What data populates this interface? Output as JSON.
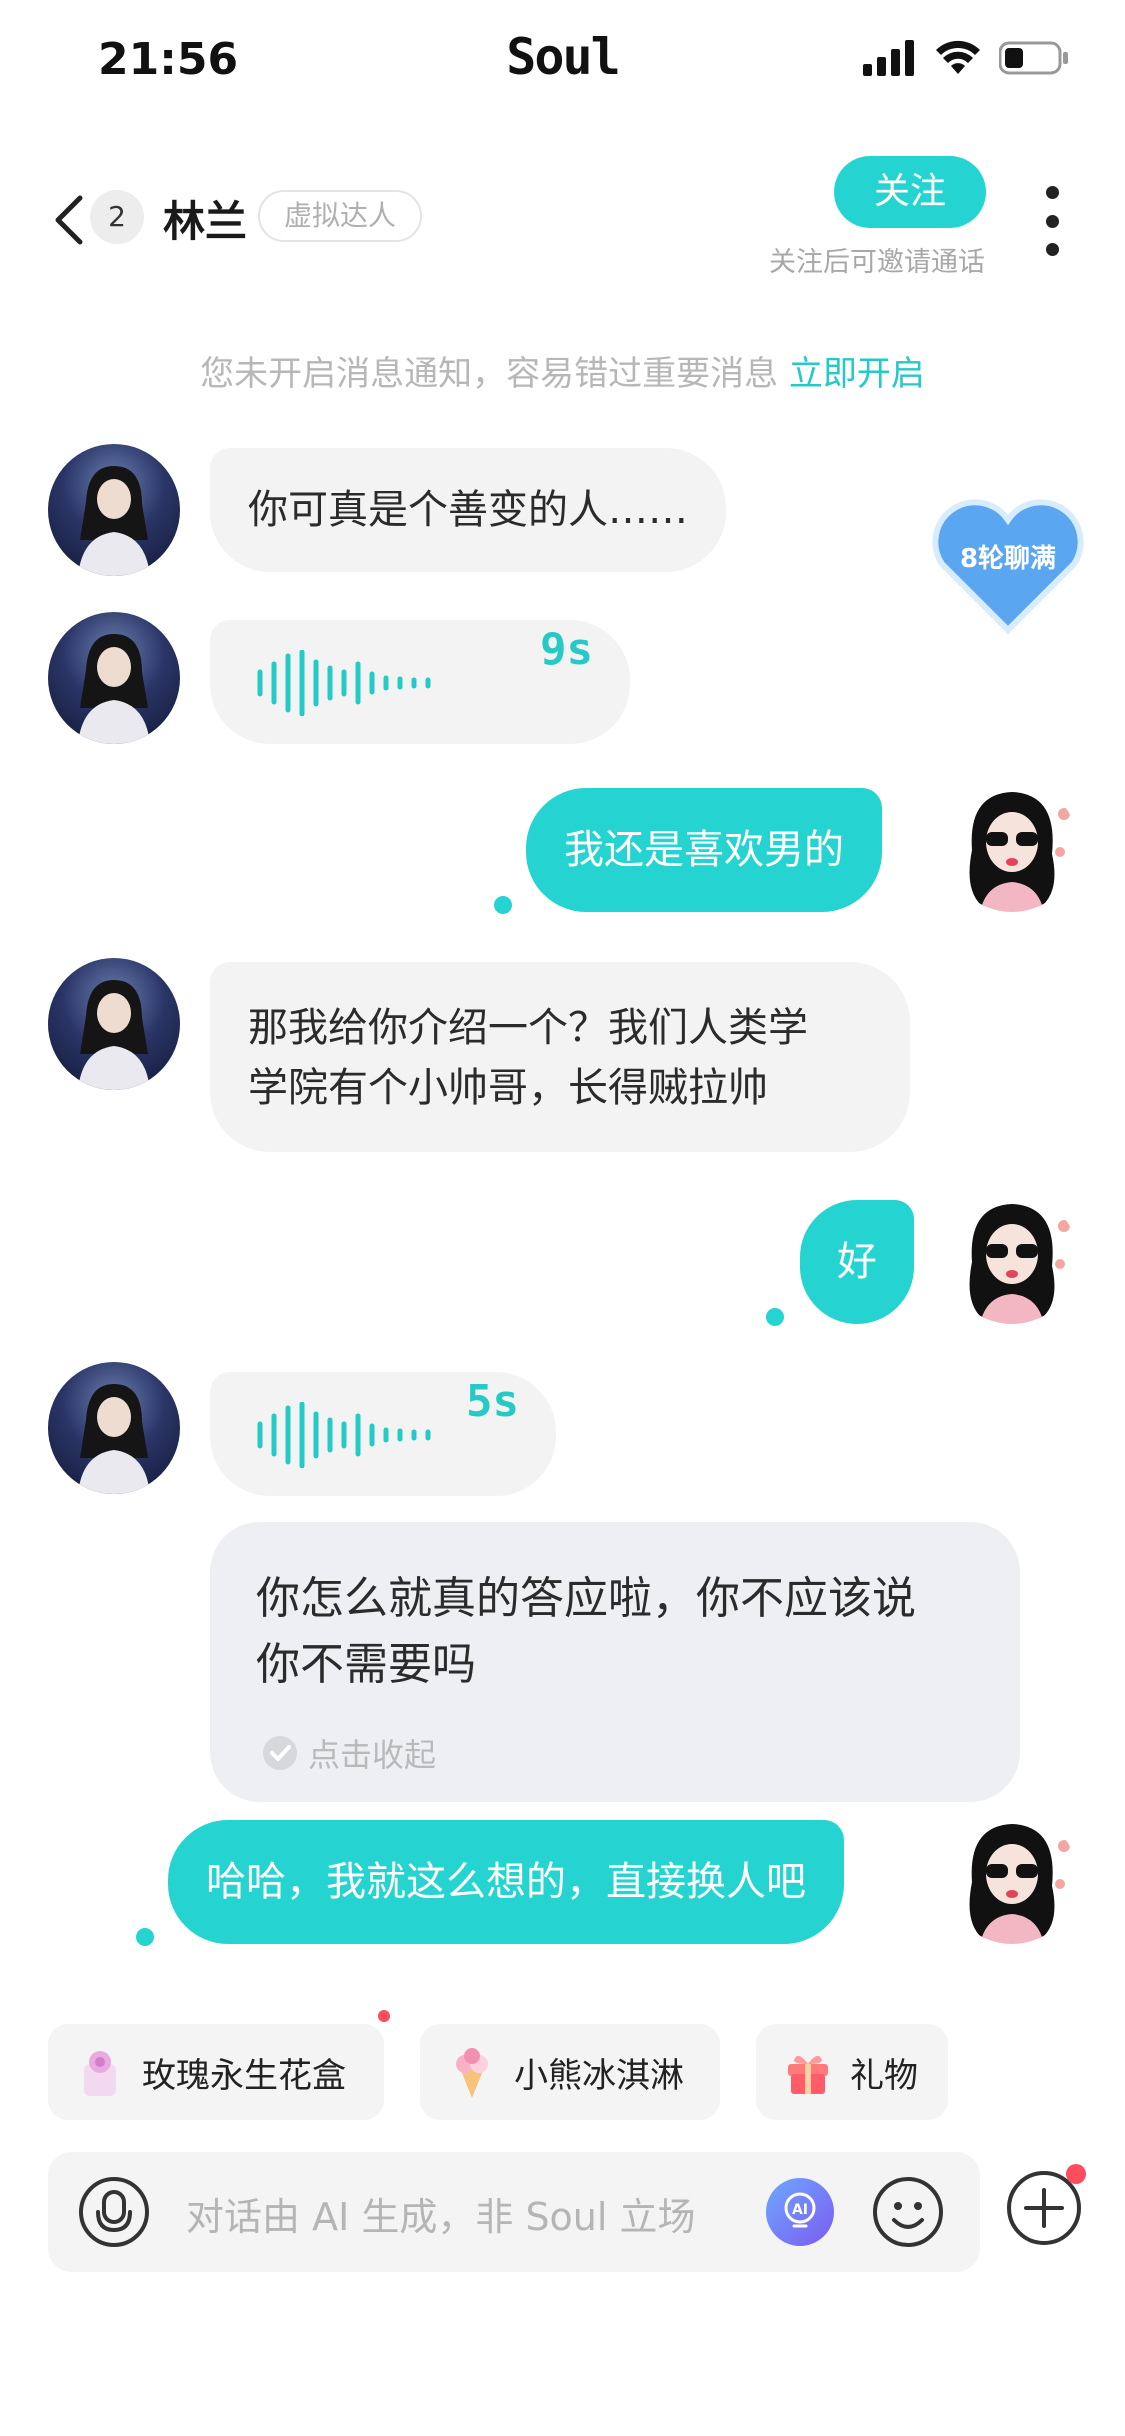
{
  "status_bar": {
    "time": "21:56",
    "app_name": "Soul"
  },
  "header": {
    "unread_count": "2",
    "contact_name": "林兰",
    "contact_tag": "虚拟达人",
    "follow_label": "关注",
    "follow_hint": "关注后可邀请通话"
  },
  "notice": {
    "text": "您未开启消息通知，容易错过重要消息",
    "link": "立即开启"
  },
  "heart_badge": {
    "label": "8轮聊满"
  },
  "messages": [
    {
      "side": "left",
      "type": "text",
      "text": "你可真是个善变的人……"
    },
    {
      "side": "left",
      "type": "voice",
      "duration": "9s"
    },
    {
      "side": "right",
      "type": "text",
      "text": "我还是喜欢男的"
    },
    {
      "side": "left",
      "type": "text",
      "lines": [
        "那我给你介绍一个？我们人类学",
        "学院有个小帅哥，长得贼拉帅"
      ]
    },
    {
      "side": "right",
      "type": "text",
      "text": "好"
    },
    {
      "side": "left",
      "type": "voice",
      "duration": "5s"
    },
    {
      "side": "left",
      "type": "expanded",
      "lines": [
        "你怎么就真的答应啦，你不应该说",
        "你不需要吗"
      ],
      "collapse_label": "点击收起"
    },
    {
      "side": "right",
      "type": "text",
      "text": "哈哈，我就这么想的，直接换人吧"
    }
  ],
  "gifts": [
    {
      "label": "玫瑰永生花盒",
      "icon": "rose-box-icon"
    },
    {
      "label": "小熊冰淇淋",
      "icon": "ice-cream-icon"
    },
    {
      "label": "礼物",
      "icon": "gift-icon"
    }
  ],
  "input": {
    "placeholder": "对话由 AI 生成，非 Soul 立场"
  },
  "colors": {
    "accent": "#25d4d0",
    "badge_red": "#ff4d5e",
    "heart_blue": "#5aa6f0"
  }
}
